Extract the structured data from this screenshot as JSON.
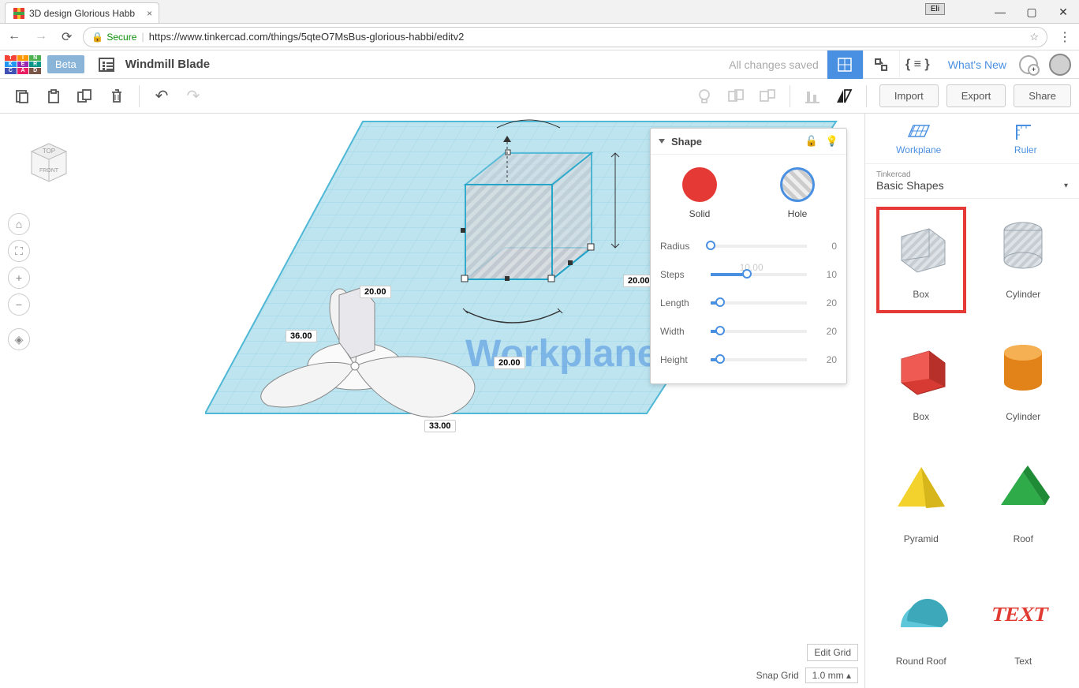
{
  "browser": {
    "tab_title": "3D design Glorious Habb",
    "url": "https://www.tinkercad.com/things/5qteO7MsBus-glorious-habbi/editv2",
    "secure_label": "Secure",
    "user_badge": "Eli"
  },
  "app": {
    "beta_label": "Beta",
    "doc_title": "Windmill Blade",
    "saved_msg": "All changes saved",
    "whats_new": "What's New"
  },
  "toolbar": {
    "import": "Import",
    "export": "Export",
    "share": "Share"
  },
  "viewcube": {
    "top": "TOP",
    "front": "FRONT"
  },
  "dimensions": {
    "d1": "20.00",
    "d2": "20.00",
    "d3": "20.00",
    "d4": "36.00",
    "d5": "33.00"
  },
  "shape_panel": {
    "title": "Shape",
    "solid": "Solid",
    "hole": "Hole",
    "props": [
      {
        "label": "Radius",
        "value": "0",
        "pct": 0
      },
      {
        "label": "Steps",
        "value": "10",
        "pct": 38,
        "ghost": "10.00"
      },
      {
        "label": "Length",
        "value": "20",
        "pct": 10
      },
      {
        "label": "Width",
        "value": "20",
        "pct": 10
      },
      {
        "label": "Height",
        "value": "20",
        "pct": 10
      }
    ]
  },
  "sidebar": {
    "workplane": "Workplane",
    "ruler": "Ruler",
    "cat_small": "Tinkercad",
    "cat_big": "Basic Shapes",
    "shapes": [
      {
        "name": "Box",
        "selected": true
      },
      {
        "name": "Cylinder"
      },
      {
        "name": "Box"
      },
      {
        "name": "Cylinder"
      },
      {
        "name": "Pyramid"
      },
      {
        "name": "Roof"
      },
      {
        "name": "Round Roof"
      },
      {
        "name": "Text"
      }
    ]
  },
  "footer": {
    "edit_grid": "Edit Grid",
    "snap_label": "Snap Grid",
    "snap_value": "1.0 mm"
  },
  "workplane_text": "Workplane"
}
